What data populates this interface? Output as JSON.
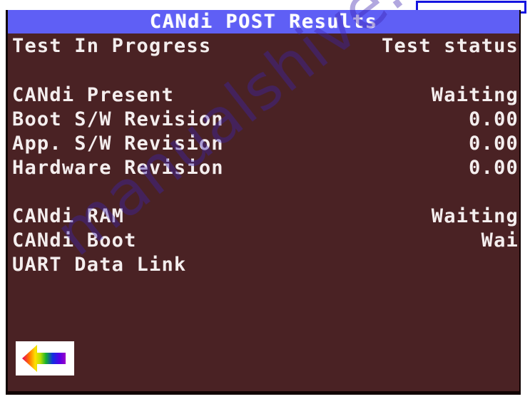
{
  "window": {
    "title": "CANdi POST Results",
    "title_bar_color": "#5f5ff5",
    "background_color": "#4a2224",
    "text_color": "#f4eeee"
  },
  "top_entry_box": {
    "value": "",
    "placeholder": "",
    "border_color": "#1515e0"
  },
  "header": {
    "left_label": "Test In Progress",
    "right_label": "Test status"
  },
  "results": [
    {
      "label": "CANdi Present",
      "value": "Waiting"
    },
    {
      "label": "Boot S/W Revision",
      "value": "0.00"
    },
    {
      "label": "App. S/W Revision",
      "value": "0.00"
    },
    {
      "label": "Hardware Revision",
      "value": "0.00"
    },
    {
      "label": "CANdi RAM",
      "value": "Waiting"
    },
    {
      "label": "CANdi Boot",
      "value": "Wai"
    },
    {
      "label": "UART Data Link",
      "value": ""
    }
  ],
  "back_button": {
    "icon": "rainbow-left-arrow-icon",
    "label": ""
  },
  "watermark": {
    "text": "manualshive.com"
  }
}
